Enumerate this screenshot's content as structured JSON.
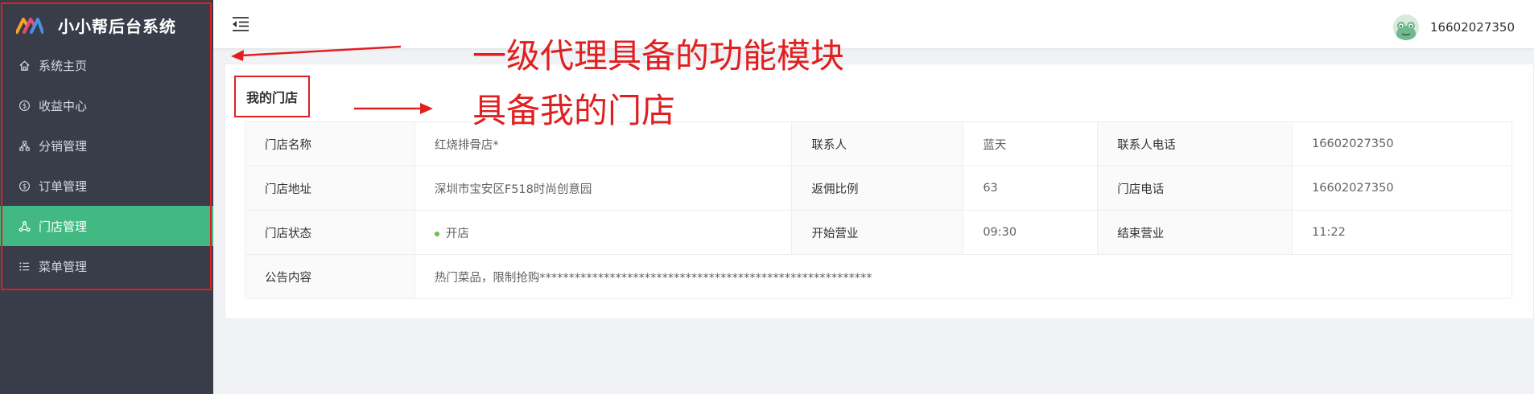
{
  "app": {
    "title": "小小帮后台系统"
  },
  "sidebar": {
    "items": [
      {
        "label": "系统主页",
        "icon": "home-icon"
      },
      {
        "label": "收益中心",
        "icon": "dollar-circle-icon"
      },
      {
        "label": "分销管理",
        "icon": "hierarchy-icon"
      },
      {
        "label": "订单管理",
        "icon": "dollar-circle-icon"
      },
      {
        "label": "门店管理",
        "icon": "network-icon",
        "active": true
      },
      {
        "label": "菜单管理",
        "icon": "list-icon"
      }
    ],
    "active_color": "#42b983"
  },
  "header": {
    "username": "16602027350"
  },
  "store": {
    "title": "我的门店",
    "rows": [
      [
        {
          "label": "门店名称",
          "value": "红烧排骨店*"
        },
        {
          "label": "联系人",
          "value": "蓝天"
        },
        {
          "label": "联系人电话",
          "value": "16602027350"
        }
      ],
      [
        {
          "label": "门店地址",
          "value": "深圳市宝安区F518时尚创意园"
        },
        {
          "label": "返佣比例",
          "value": "63"
        },
        {
          "label": "门店电话",
          "value": "16602027350"
        }
      ],
      [
        {
          "label": "门店状态",
          "value": "开店"
        },
        {
          "label": "开始营业",
          "value": "09:30"
        },
        {
          "label": "结束营业",
          "value": "11:22"
        }
      ]
    ],
    "notice": {
      "label": "公告内容",
      "value": "热门菜品，限制抢购*********************************************************"
    }
  },
  "annotations": {
    "text1": "一级代理具备的功能模块",
    "text2": "具备我的门店",
    "color": "#e02020"
  }
}
